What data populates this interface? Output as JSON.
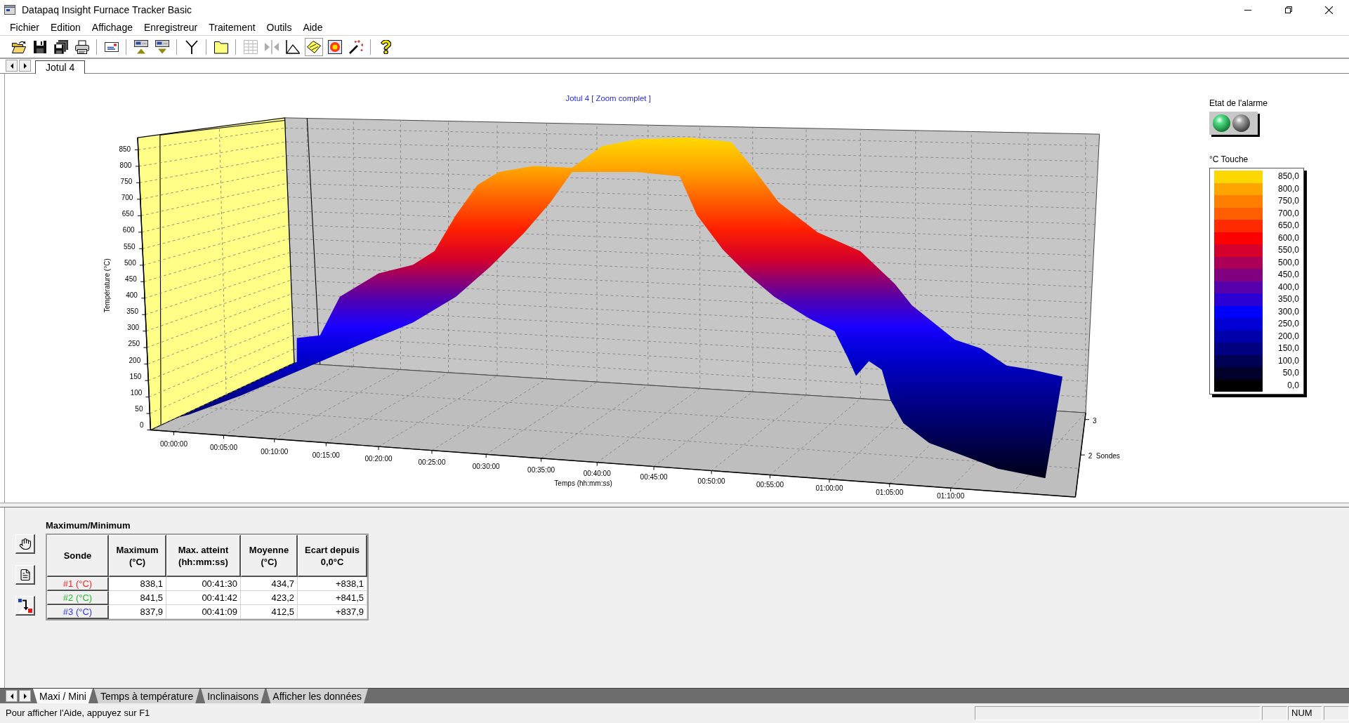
{
  "window": {
    "title": "Datapaq Insight Furnace Tracker Basic"
  },
  "menu": [
    "Fichier",
    "Edition",
    "Affichage",
    "Enregistreur",
    "Traitement",
    "Outils",
    "Aide"
  ],
  "toolbar": [
    {
      "kind": "open",
      "disabled": false,
      "pressed": false
    },
    {
      "kind": "save",
      "disabled": false,
      "pressed": false
    },
    {
      "kind": "saveall",
      "disabled": false,
      "pressed": false
    },
    {
      "kind": "print",
      "disabled": false,
      "pressed": false
    },
    {
      "kind": "separator"
    },
    {
      "kind": "card",
      "disabled": false,
      "pressed": false
    },
    {
      "kind": "separator"
    },
    {
      "kind": "upload",
      "disabled": false,
      "pressed": false
    },
    {
      "kind": "download",
      "disabled": false,
      "pressed": false
    },
    {
      "kind": "separator"
    },
    {
      "kind": "antenna",
      "disabled": false,
      "pressed": false
    },
    {
      "kind": "separator"
    },
    {
      "kind": "folder",
      "disabled": false,
      "pressed": false
    },
    {
      "kind": "separator"
    },
    {
      "kind": "table",
      "disabled": true,
      "pressed": false
    },
    {
      "kind": "split",
      "disabled": true,
      "pressed": false
    },
    {
      "kind": "axes",
      "disabled": false,
      "pressed": false
    },
    {
      "kind": "surface",
      "disabled": false,
      "pressed": true
    },
    {
      "kind": "burst",
      "disabled": false,
      "pressed": false
    },
    {
      "kind": "wand",
      "disabled": false,
      "pressed": false
    },
    {
      "kind": "separator"
    },
    {
      "kind": "help",
      "disabled": false,
      "pressed": false
    }
  ],
  "document_tabs": [
    {
      "label": "Jotul 4",
      "selected": true
    }
  ],
  "chart": {
    "title": "Jotul 4 [ Zoom complet ]",
    "y_axis_label": "Température (°C)",
    "y_ticks": [
      "850",
      "800",
      "750",
      "700",
      "650",
      "600",
      "550",
      "500",
      "450",
      "400",
      "350",
      "300",
      "250",
      "200",
      "150",
      "100",
      "50",
      "0"
    ],
    "x_axis_label": "Temps (hh:mm:ss)",
    "x_ticks": [
      "00:00:00",
      "00:05:00",
      "00:10:00",
      "00:15:00",
      "00:20:00",
      "00:25:00",
      "00:30:00",
      "00:35:00",
      "00:40:00",
      "00:45:00",
      "00:50:00",
      "00:55:00",
      "01:00:00",
      "01:05:00",
      "01:10:00"
    ],
    "depth_ticks": [
      "3",
      "2"
    ],
    "depth_axis_label": "Sondes"
  },
  "alarm": {
    "label": "Etat de l'alarme",
    "lights": [
      {
        "on": true
      },
      {
        "on": false
      }
    ]
  },
  "color_legend": {
    "title": "°C Touche",
    "items": [
      {
        "label": "850,0",
        "color": "#ffd700"
      },
      {
        "label": "800,0",
        "color": "#ffa500"
      },
      {
        "label": "750,0",
        "color": "#ff8000"
      },
      {
        "label": "700,0",
        "color": "#ff5f00"
      },
      {
        "label": "650,0",
        "color": "#ff2a00"
      },
      {
        "label": "600,0",
        "color": "#ff0000"
      },
      {
        "label": "550,0",
        "color": "#d4002b"
      },
      {
        "label": "500,0",
        "color": "#aa0055"
      },
      {
        "label": "450,0",
        "color": "#800080"
      },
      {
        "label": "400,0",
        "color": "#5500aa"
      },
      {
        "label": "350,0",
        "color": "#2b00d4"
      },
      {
        "label": "300,0",
        "color": "#0000ff"
      },
      {
        "label": "250,0",
        "color": "#0000d4"
      },
      {
        "label": "200,0",
        "color": "#0000aa"
      },
      {
        "label": "150,0",
        "color": "#000080"
      },
      {
        "label": "100,0",
        "color": "#000055"
      },
      {
        "label": "50,0",
        "color": "#00002b"
      },
      {
        "label": "0,0",
        "color": "#000000"
      }
    ]
  },
  "stats": {
    "title": "Maximum/Minimum",
    "columns": [
      "Sonde",
      "Maximum\n(°C)",
      "Max. atteint\n(hh:mm:ss)",
      "Moyenne\n(°C)",
      "Ecart depuis\n0,0°C"
    ],
    "rows": [
      {
        "color": "#ff2020",
        "cells": [
          "#1 (°C)",
          "838,1",
          "00:41:30",
          "434,7",
          "+838,1"
        ]
      },
      {
        "color": "#22b822",
        "cells": [
          "#2 (°C)",
          "841,5",
          "00:41:42",
          "423,2",
          "+841,5"
        ]
      },
      {
        "color": "#3030ff",
        "cells": [
          "#3 (°C)",
          "837,9",
          "00:41:09",
          "412,5",
          "+837,9"
        ]
      }
    ]
  },
  "sheet_tabs": [
    {
      "label": "Maxi / Mini",
      "selected": true
    },
    {
      "label": "Temps à température",
      "selected": false
    },
    {
      "label": "Inclinaisons",
      "selected": false
    },
    {
      "label": "Afficher les données",
      "selected": false
    }
  ],
  "status_bar": {
    "message": "Pour afficher l'Aide, appuyez sur F1",
    "indicator": "NUM"
  }
}
